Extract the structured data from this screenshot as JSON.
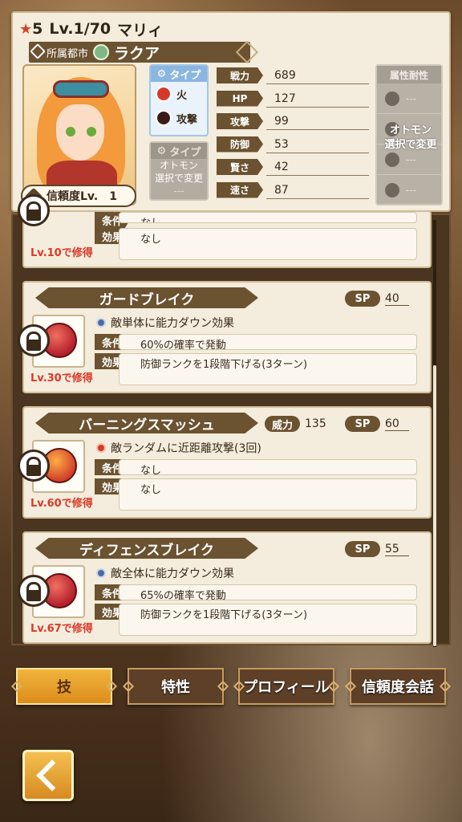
{
  "header": {
    "rarity": "5",
    "level": "Lv.1/70",
    "name": "マリィ",
    "city_label": "所属都市",
    "city_name": "ラクア",
    "trust": "信頼度Lv.　1"
  },
  "type_panel": {
    "head": "タイプ",
    "items": [
      {
        "label": "火",
        "icon": "fire-icon"
      },
      {
        "label": "攻撃",
        "icon": "attack-icon"
      }
    ],
    "otomon_head": "タイプ",
    "otomon_lines": [
      "オトモン",
      "選択で変更"
    ],
    "dash": "---"
  },
  "stats": [
    {
      "label": "戦力",
      "value": "689"
    },
    {
      "label": "HP",
      "value": "127"
    },
    {
      "label": "攻撃",
      "value": "99"
    },
    {
      "label": "防御",
      "value": "53"
    },
    {
      "label": "賢さ",
      "value": "42"
    },
    {
      "label": "速さ",
      "value": "87"
    }
  ],
  "attributes": {
    "head": "属性耐性",
    "note_lines": [
      "オトモン",
      "選択で変更"
    ],
    "rows": [
      "---",
      "---",
      "---",
      "---"
    ]
  },
  "skills": [
    {
      "name": "",
      "cond_label": "条件",
      "cond": "なし",
      "effect_label": "効果",
      "effect": "なし",
      "lv": "Lv.10で修得"
    },
    {
      "name": "ガードブレイク",
      "sp_label": "SP",
      "sp": "40",
      "desc": "敵単体に能力ダウン効果",
      "cond_label": "条件",
      "cond": "60%の確率で発動",
      "effect_label": "効果",
      "effect": "防御ランクを1段階下げる(3ターン)",
      "lv": "Lv.30で修得"
    },
    {
      "name": "バーニングスマッシュ",
      "power_label": "威力",
      "power": "135",
      "sp_label": "SP",
      "sp": "60",
      "desc": "敵ランダムに近距離攻撃(3回)",
      "cond_label": "条件",
      "cond": "なし",
      "effect_label": "効果",
      "effect": "なし",
      "lv": "Lv.60で修得"
    },
    {
      "name": "ディフェンスブレイク",
      "sp_label": "SP",
      "sp": "55",
      "desc": "敵全体に能力ダウン効果",
      "cond_label": "条件",
      "cond": "65%の確率で発動",
      "effect_label": "効果",
      "effect": "防御ランクを1段階下げる(3ターン)",
      "lv": "Lv.67で修得"
    }
  ],
  "tabs": [
    "技",
    "特性",
    "プロフィール",
    "信頼度会話"
  ],
  "colors": {
    "accent": "#e9a22a",
    "label_bg": "#6b5230",
    "req_red": "#d83a2a"
  }
}
